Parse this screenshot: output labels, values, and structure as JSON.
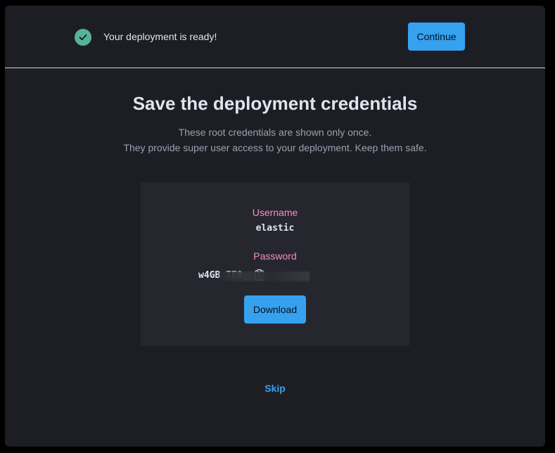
{
  "banner": {
    "message": "Your deployment is ready!",
    "continue_label": "Continue",
    "status_icon": "check-circle-icon",
    "status_color": "#54b399"
  },
  "main": {
    "title": "Save the deployment credentials",
    "subtitle_line1": "These root credentials are shown only once.",
    "subtitle_line2": "They provide super user access to your deployment. Keep them safe."
  },
  "credentials": {
    "username_label": "Username",
    "username_value": "elastic",
    "password_label": "Password",
    "password_value": "w4GB                      TE0",
    "copy_icon": "copy-clipboard-icon",
    "download_label": "Download"
  },
  "footer": {
    "skip_label": "Skip"
  },
  "colors": {
    "accent": "#36a2ef",
    "label_pink": "#f68fbe",
    "background": "#1d1e24",
    "panel": "#25262e"
  }
}
